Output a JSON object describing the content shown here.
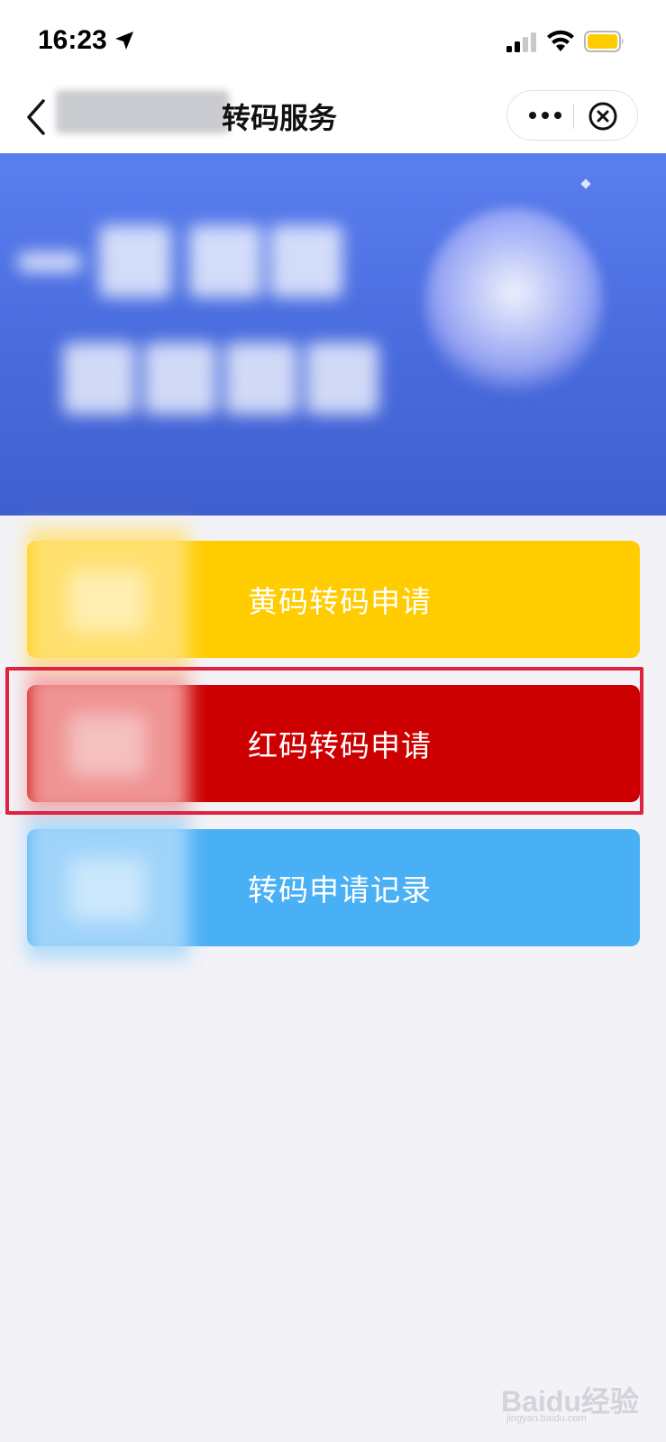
{
  "status_bar": {
    "time": "16:23",
    "icons": [
      "location-arrow-icon",
      "signal-icon",
      "wifi-icon",
      "battery-icon"
    ],
    "battery_color": "#ffcc00"
  },
  "nav": {
    "title": "转码服务",
    "icons": [
      "back-icon",
      "more-icon",
      "close-icon"
    ]
  },
  "banner": {
    "colors": [
      "#5b7ff0",
      "#3f5fcf"
    ]
  },
  "actions": [
    {
      "label": "黄码转码申请",
      "color": "#ffcc00",
      "icon_tint": "#ffe27a"
    },
    {
      "label": "红码转码申请",
      "color": "#cc0000",
      "icon_tint": "#f4a3a3"
    },
    {
      "label": "转码申请记录",
      "color": "#4ab0f5",
      "icon_tint": "#a9d8fb"
    }
  ],
  "highlight_color": "#e0213f",
  "watermark": {
    "brand": "Baidu经验",
    "url": "jingyan.baidu.com"
  }
}
